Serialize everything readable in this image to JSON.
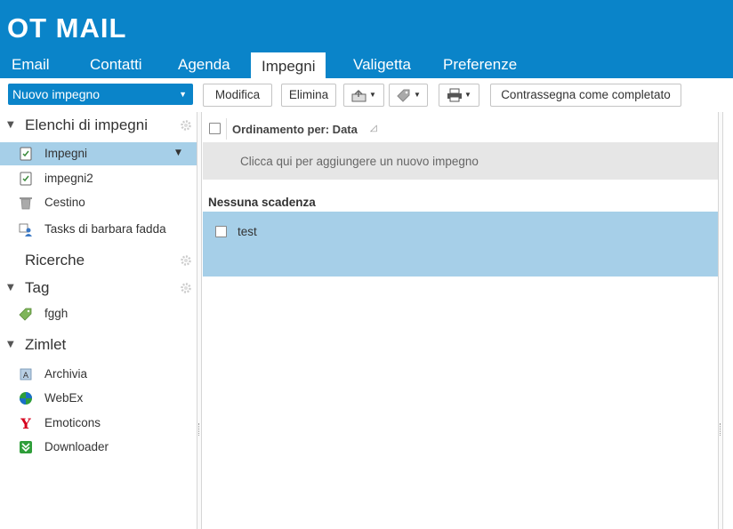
{
  "app": {
    "logo": "OT MAIL"
  },
  "tabs": [
    {
      "label": "Email"
    },
    {
      "label": "Contatti"
    },
    {
      "label": "Agenda"
    },
    {
      "label": "Impegni",
      "active": true
    },
    {
      "label": "Valigetta"
    },
    {
      "label": "Preferenze"
    }
  ],
  "toolbar": {
    "new_label": "Nuovo impegno",
    "edit_label": "Modifica",
    "delete_label": "Elimina",
    "mark_complete_label": "Contrassegna come completato"
  },
  "sidebar": {
    "tasklists": {
      "title": "Elenchi di impegni",
      "items": [
        {
          "label": "Impegni",
          "icon": "task-list-icon",
          "selected": true
        },
        {
          "label": "impegni2",
          "icon": "task-list-icon"
        },
        {
          "label": "Cestino",
          "icon": "trash-icon"
        },
        {
          "label": "Tasks di barbara fadda",
          "icon": "shared-folder-icon"
        }
      ]
    },
    "searches": {
      "title": "Ricerche"
    },
    "tags": {
      "title": "Tag",
      "items": [
        {
          "label": "fggh",
          "icon": "tag-icon"
        }
      ]
    },
    "zimlets": {
      "title": "Zimlet",
      "items": [
        {
          "label": "Archivia",
          "icon": "archive-icon"
        },
        {
          "label": "WebEx",
          "icon": "webex-icon"
        },
        {
          "label": "Emoticons",
          "icon": "yahoo-icon"
        },
        {
          "label": "Downloader",
          "icon": "downloader-icon"
        }
      ]
    }
  },
  "main": {
    "sort_label": "Ordinamento per: Data",
    "add_prompt": "Clicca qui per aggiungere un nuovo impegno",
    "group_title": "Nessuna scadenza",
    "tasks": [
      {
        "label": "test"
      }
    ]
  },
  "colors": {
    "brand": "#0a84c9",
    "selection": "#a6cfe8",
    "add_row_bg": "#e6e6e6"
  }
}
